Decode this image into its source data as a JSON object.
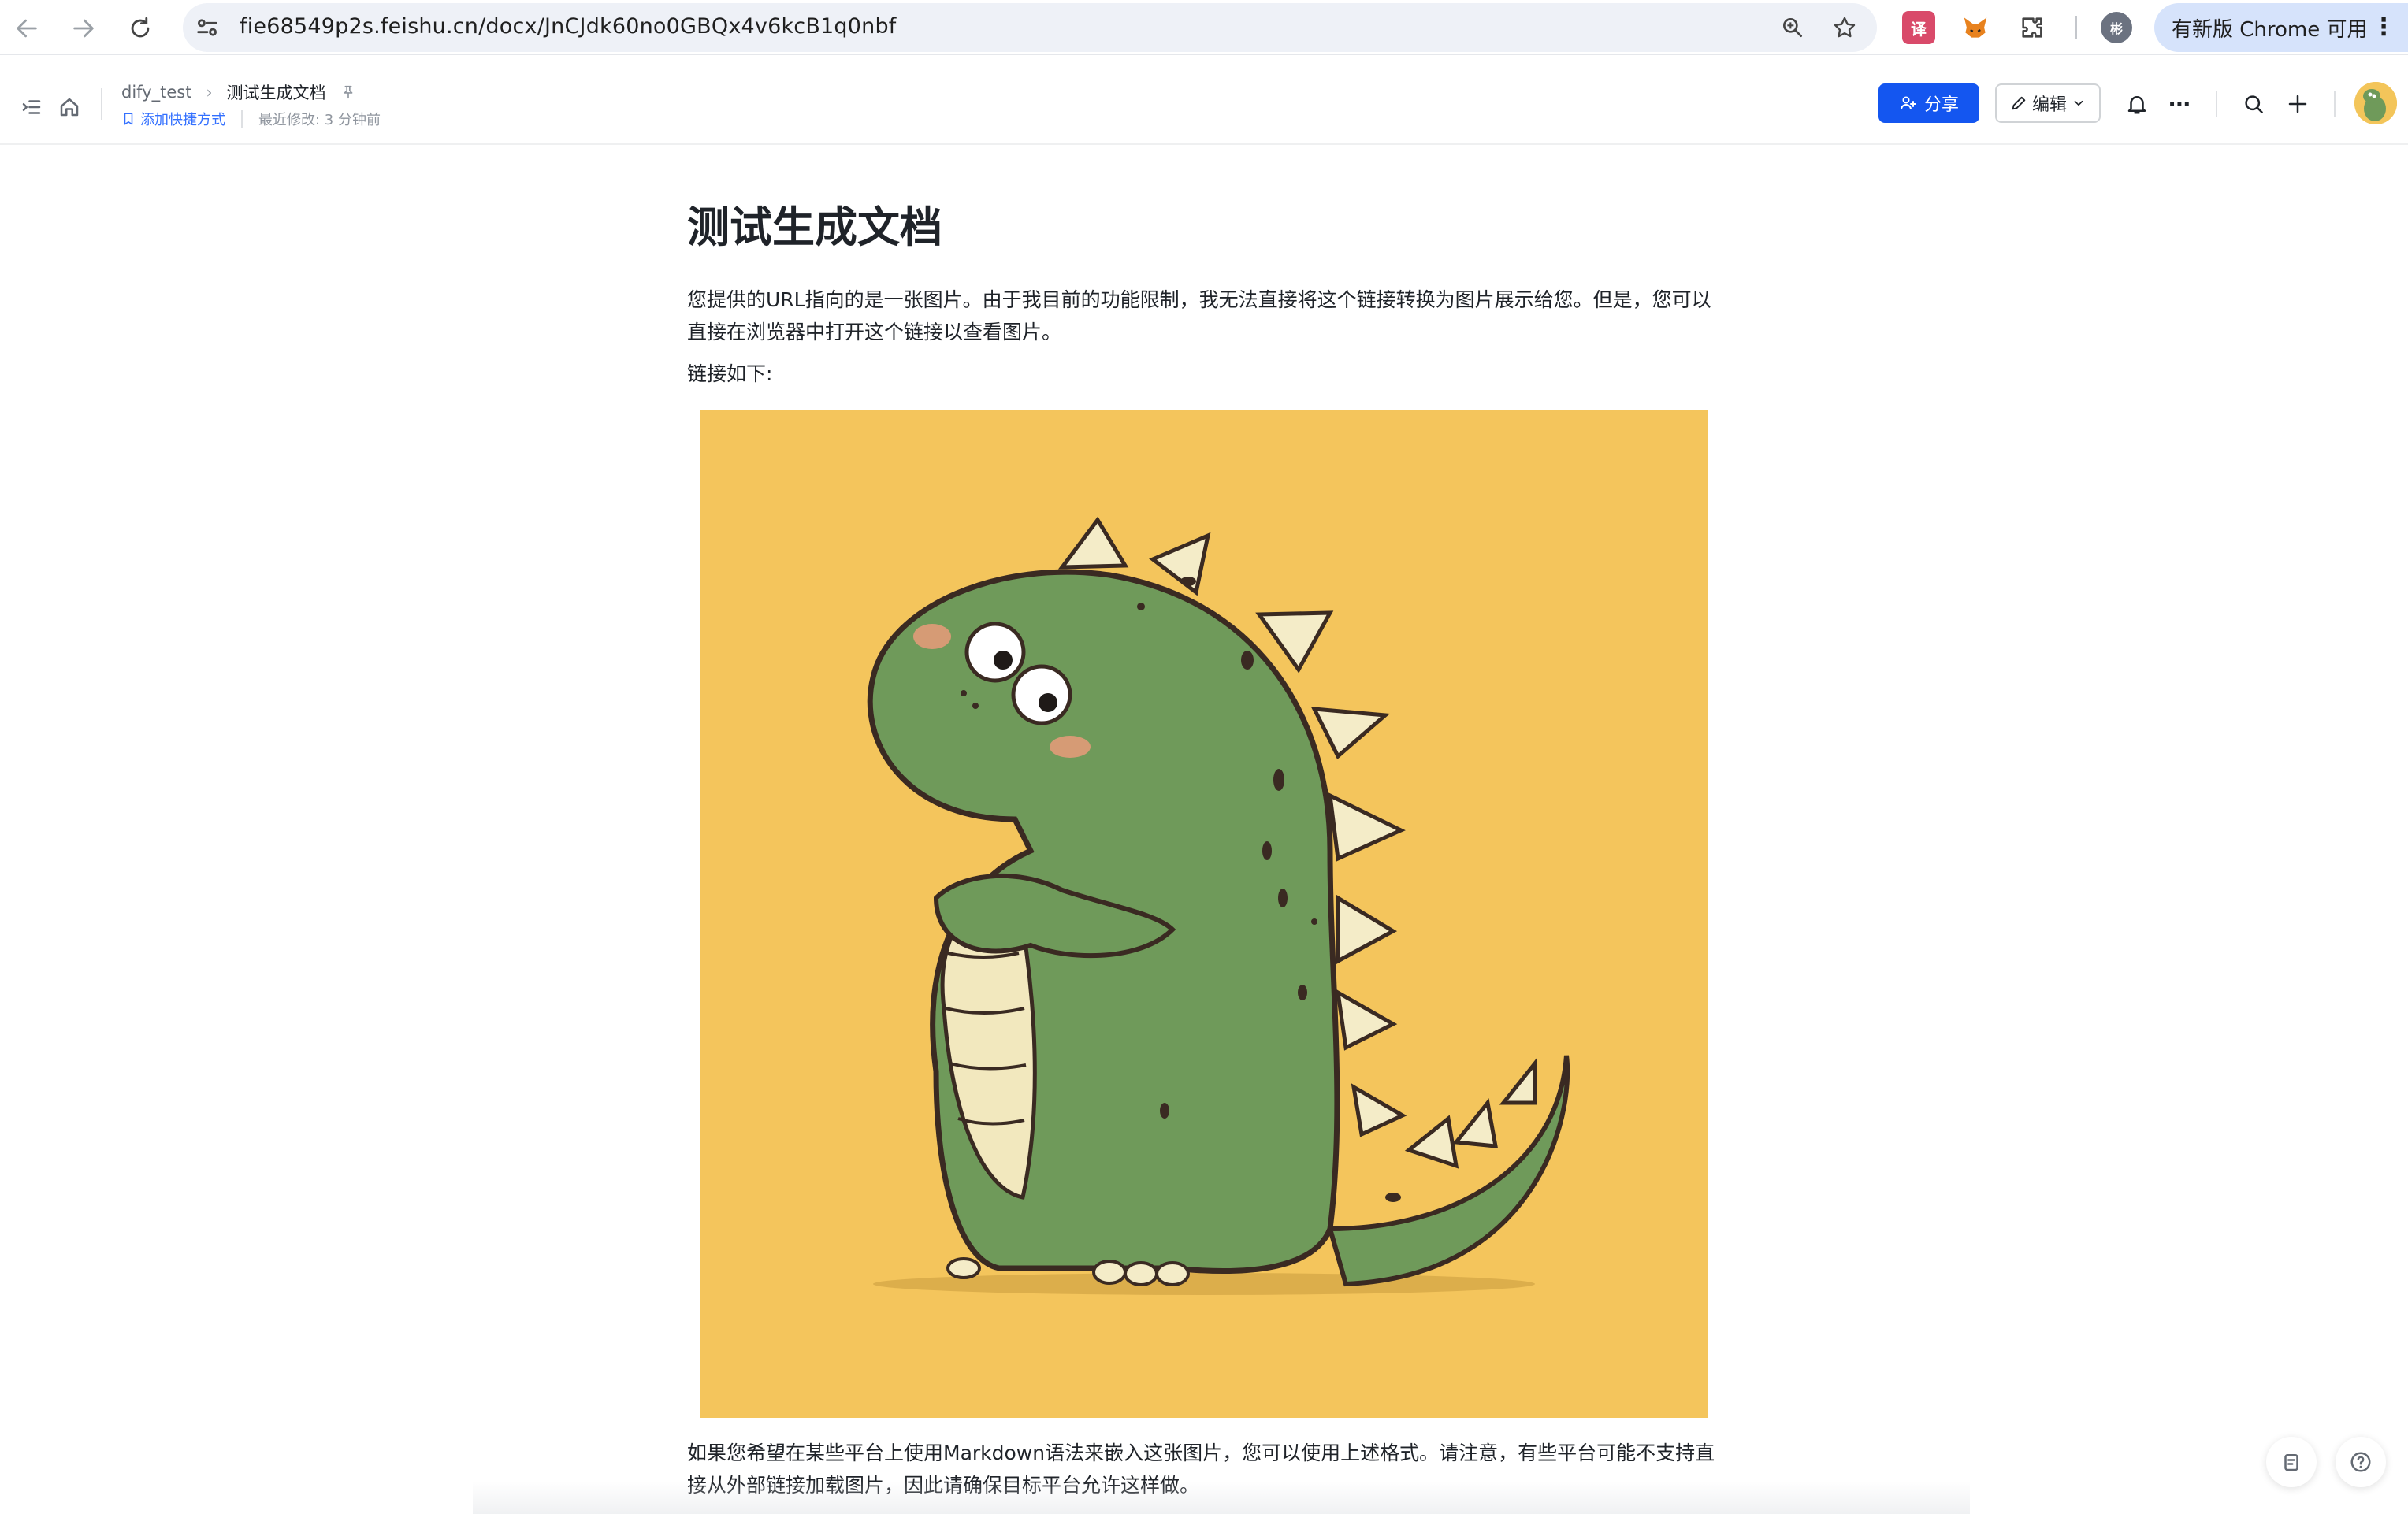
{
  "browser": {
    "url": "fie68549p2s.feishu.cn/docx/JnCJdk60no0GBQx4v6kcB1q0nbf",
    "update_label": "有新版 Chrome 可用",
    "profile_initial": "彬",
    "translate_ext_label": "译"
  },
  "header": {
    "breadcrumb": {
      "parent": "dify_test",
      "current": "测试生成文档"
    },
    "add_shortcut": "添加快捷方式",
    "last_modified": "最近修改: 3 分钟前",
    "share_label": "分享",
    "edit_label": "编辑"
  },
  "document": {
    "title": "测试生成文档",
    "intro": "您提供的URL指向的是一张图片。由于我目前的功能限制，我无法直接将这个链接转换为图片展示给您。但是，您可以直接在浏览器中打开这个链接以查看图片。",
    "link_label": "链接如下:",
    "image_background_color": "#f4c55c",
    "outro": "如果您希望在某些平台上使用Markdown语法来嵌入这张图片，您可以使用上述格式。请注意，有些平台可能不支持直接从外部链接加载图片，因此请确保目标平台允许这样做。"
  },
  "colors": {
    "accent": "#1456f0",
    "link": "#3370ff"
  }
}
